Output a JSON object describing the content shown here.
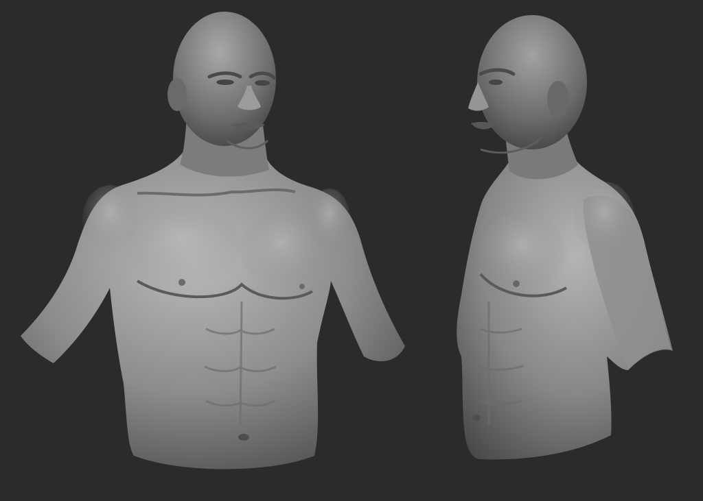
{
  "scene": {
    "background_color": "#2b2b2b",
    "material_color": "#8a8a8a",
    "highlight_color": "#c4c4c4",
    "shadow_color": "#3a3a3a",
    "views": [
      {
        "name": "front-three-quarter"
      },
      {
        "name": "left-profile"
      }
    ]
  }
}
